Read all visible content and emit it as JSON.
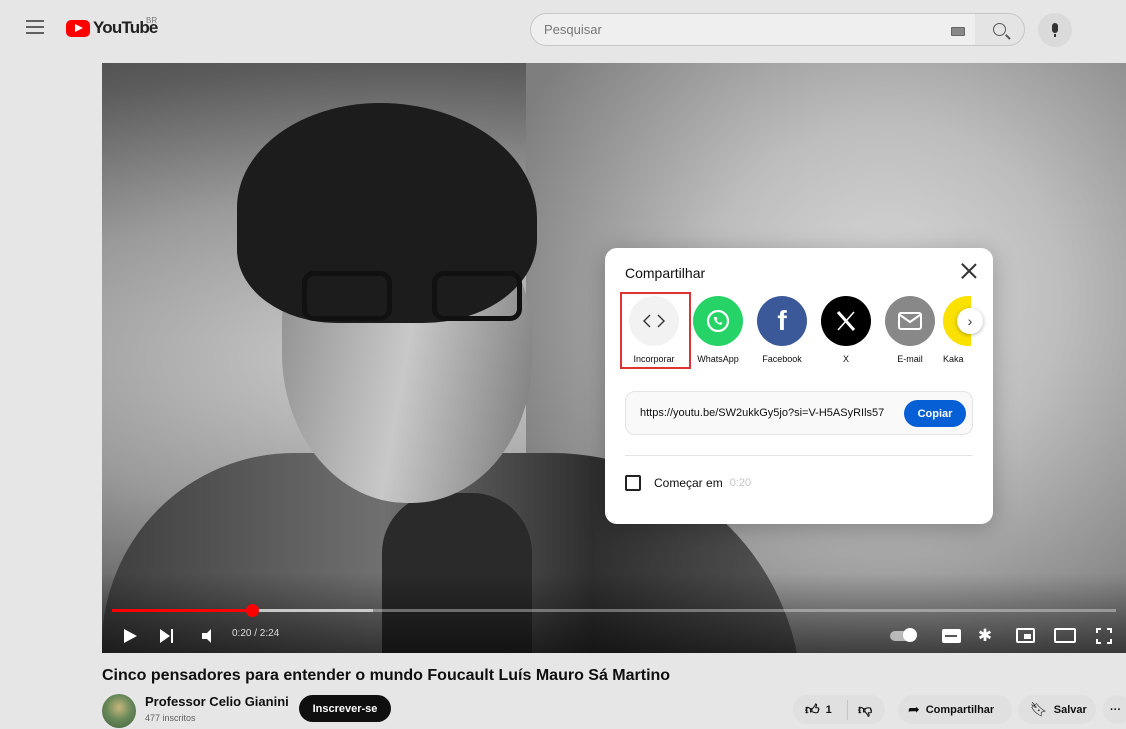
{
  "header": {
    "logo_text": "YouTube",
    "country_code": "BR",
    "search_placeholder": "Pesquisar"
  },
  "player": {
    "time_display": "0:20 / 2:24",
    "progress_played_fraction": 0.139,
    "progress_loaded_fraction": 0.26
  },
  "share_dialog": {
    "title": "Compartilhar",
    "targets": [
      {
        "label": "Incorporar",
        "icon": "embed-code-icon",
        "color": "#f2f2f2"
      },
      {
        "label": "WhatsApp",
        "icon": "whatsapp-icon",
        "color": "#25d366"
      },
      {
        "label": "Facebook",
        "icon": "facebook-icon",
        "color": "#3b5998"
      },
      {
        "label": "X",
        "icon": "x-icon",
        "color": "#000000"
      },
      {
        "label": "E-mail",
        "icon": "email-icon",
        "color": "#888888"
      },
      {
        "label": "Kaka",
        "icon": "kakaotalk-icon",
        "color": "#fae100"
      }
    ],
    "link": "https://youtu.be/SW2ukkGy5jo?si=V-H5ASyRIls57",
    "copy_label": "Copiar",
    "start_label": "Começar em",
    "start_time": "0:20"
  },
  "video": {
    "title": "Cinco pensadores para entender o mundo Foucault Luís Mauro Sá Martino",
    "channel_name": "Professor Celio Gianini",
    "subscribers": "477 inscritos",
    "subscribe_label": "Inscrever-se",
    "likes": "1",
    "share_label": "Compartilhar",
    "save_label": "Salvar",
    "more_label": "···"
  },
  "colors": {
    "youtube_red": "#ff0000",
    "copy_blue": "#065fd4",
    "highlight_red": "#d33333"
  }
}
